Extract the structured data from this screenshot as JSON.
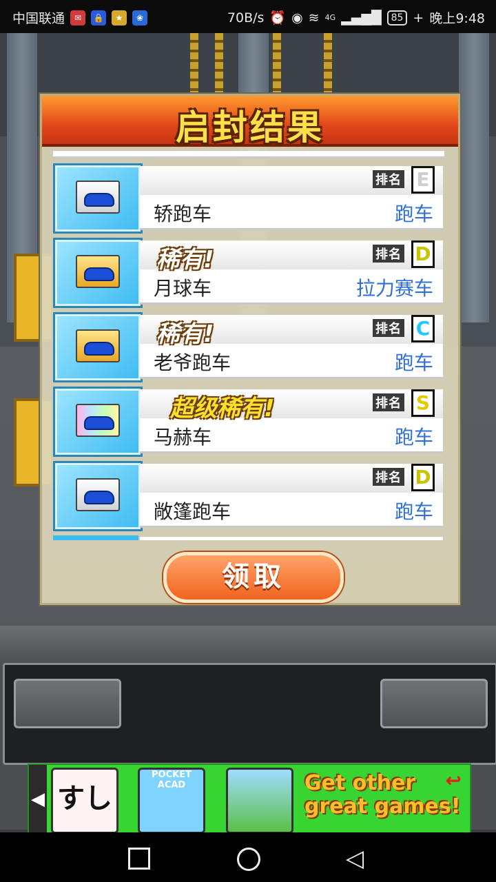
{
  "status_bar": {
    "carrier": "中国联通",
    "net_speed": "70B/s",
    "network": "4G",
    "battery": "85",
    "time": "晚上9:48"
  },
  "dialog": {
    "title": "启封结果",
    "claim_label": "领取",
    "items": [
      {
        "rarity": "",
        "grade": "E",
        "name": "轿跑车",
        "type": "跑车",
        "box": "white",
        "grade_color": "#d0d0d0"
      },
      {
        "rarity": "稀有!",
        "grade": "D",
        "name": "月球车",
        "type": "拉力赛车",
        "box": "gold",
        "grade_color": "#e8e200"
      },
      {
        "rarity": "稀有!",
        "grade": "C",
        "name": "老爷跑车",
        "type": "跑车",
        "box": "gold",
        "grade_color": "#22c8ff"
      },
      {
        "rarity": "超级稀有!",
        "grade": "S",
        "name": "马赫车",
        "type": "跑车",
        "box": "rainbow",
        "grade_color": "#ffe400"
      },
      {
        "rarity": "",
        "grade": "D",
        "name": "敞篷跑车",
        "type": "跑车",
        "box": "white",
        "grade_color": "#e8e200"
      }
    ],
    "rank_label": "排名"
  },
  "ad": {
    "cta_line1": "Get other",
    "cta_line2": "great games!",
    "game2_label": "POCKET ACAD",
    "game1_label": "すし"
  },
  "colors": {
    "accent_orange": "#e4481a",
    "title_yellow": "#ffe04a",
    "type_blue": "#2f6fd6"
  }
}
